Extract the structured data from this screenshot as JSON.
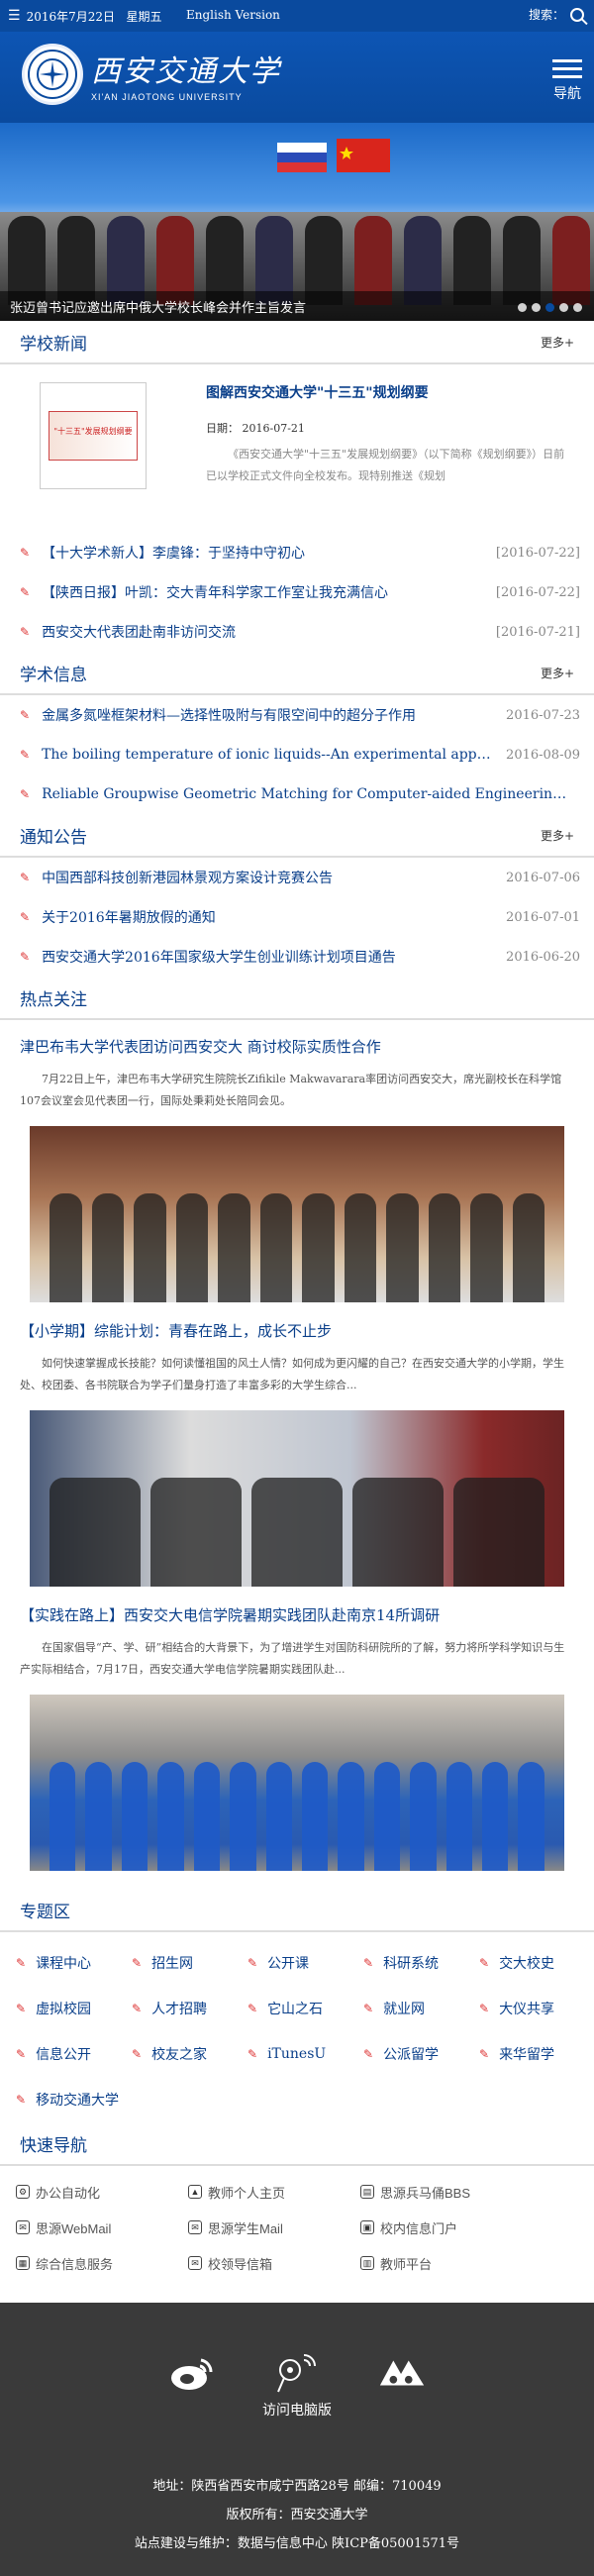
{
  "topbar": {
    "date": "2016年7月22日",
    "weekday": "星期五",
    "english": "English Version",
    "search_label": "搜索："
  },
  "header": {
    "logo_cn": "西安交通大学",
    "logo_en": "XI'AN JIAOTONG UNIVERSITY",
    "emblem": "",
    "nav_label": "导航"
  },
  "banner": {
    "caption": "张迈曾书记应邀出席中俄大学校长峰会并作主旨发言"
  },
  "news": {
    "title": "学校新闻",
    "more": "更多+",
    "featured": {
      "title": "图解西安交通大学\"十三五\"规划纲要",
      "date_label": "日期：",
      "date": "2016-07-21",
      "summary": "《西安交通大学\"十三五\"发展规划纲要》（以下简称《规划纲要》）日前已以学校正式文件向全校发布。现特别推送《规划"
    },
    "items": [
      {
        "title": "【十大学术新人】李虞锋：于坚持中守初心",
        "date": "[2016-07-22]"
      },
      {
        "title": "【陕西日报】叶凯：交大青年科学家工作室让我充满信心",
        "date": "[2016-07-22]"
      },
      {
        "title": "西安交大代表团赴南非访问交流",
        "date": "[2016-07-21]"
      }
    ]
  },
  "academic": {
    "title": "学术信息",
    "more": "更多+",
    "items": [
      {
        "title": "金属多氮唑框架材料—选择性吸附与有限空间中的超分子作用",
        "date": "2016-07-23"
      },
      {
        "title": "The boiling temperature of ionic liquids--An experimental approach",
        "date": "2016-08-09"
      },
      {
        "title": "Reliable Groupwise Geometric Matching for Computer-aided Engineering, Medi...",
        "date": ""
      }
    ]
  },
  "notice": {
    "title": "通知公告",
    "more": "更多+",
    "items": [
      {
        "title": "中国西部科技创新港园林景观方案设计竞赛公告",
        "date": "2016-07-06"
      },
      {
        "title": "关于2016年暑期放假的通知",
        "date": "2016-07-01"
      },
      {
        "title": "西安交通大学2016年国家级大学生创业训练计划项目通告",
        "date": "2016-06-20"
      }
    ]
  },
  "hot": {
    "title": "热点关注",
    "items": [
      {
        "title": "津巴布韦大学代表团访问西安交大 商讨校际实质性合作",
        "text": "7月22日上午，津巴布韦大学研究生院院长Zifikile Makwavarara率团访问西安交大，席光副校长在科学馆107会议室会见代表团一行，国际处秉莉处长陪同会见。"
      },
      {
        "title": "【小学期】综能计划：青春在路上，成长不止步",
        "text": "如何快速掌握成长技能？如何读懂祖国的风土人情？如何成为更闪耀的自己？在西安交通大学的小学期，学生处、校团委、各书院联合为学子们量身打造了丰富多彩的大学生综合..."
      },
      {
        "title": "【实践在路上】西安交大电信学院暑期实践团队赴南京14所调研",
        "text": "在国家倡导“产、学、研”相结合的大背景下，为了增进学生对国防科研院所的了解，努力将所学科学知识与生产实际相结合，7月17日，西安交通大学电信学院暑期实践团队赴..."
      }
    ]
  },
  "zone": {
    "title": "专题区",
    "items": [
      "课程中心",
      "招生网",
      "公开课",
      "科研系统",
      "交大校史",
      "虚拟校园",
      "人才招聘",
      "它山之石",
      "就业网",
      "大仪共享",
      "信息公开",
      "校友之家",
      "iTunesU",
      "公派留学",
      "来华留学",
      "移动交通大学"
    ]
  },
  "quick": {
    "title": "快速导航",
    "items": [
      {
        "label": "办公自动化",
        "icon": "gear-icon"
      },
      {
        "label": "教师个人主页",
        "icon": "graduation-cap-icon"
      },
      {
        "label": "思源兵马俑BBS",
        "icon": "board-icon"
      },
      {
        "label": "思源WebMail",
        "icon": "mail-icon"
      },
      {
        "label": "思源学生Mail",
        "icon": "mail-icon"
      },
      {
        "label": "校内信息门户",
        "icon": "portal-icon"
      },
      {
        "label": "综合信息服务",
        "icon": "service-icon"
      },
      {
        "label": "校领导信箱",
        "icon": "mail-icon"
      },
      {
        "label": "教师平台",
        "icon": "platform-icon"
      }
    ]
  },
  "footer": {
    "pc": "访问电脑版",
    "address": "地址：陕西省西安市咸宁西路28号 邮编：710049",
    "copyright": "版权所有：西安交通大学",
    "maintain": "站点建设与维护：数据与信息中心 陕ICP备05001571号"
  }
}
